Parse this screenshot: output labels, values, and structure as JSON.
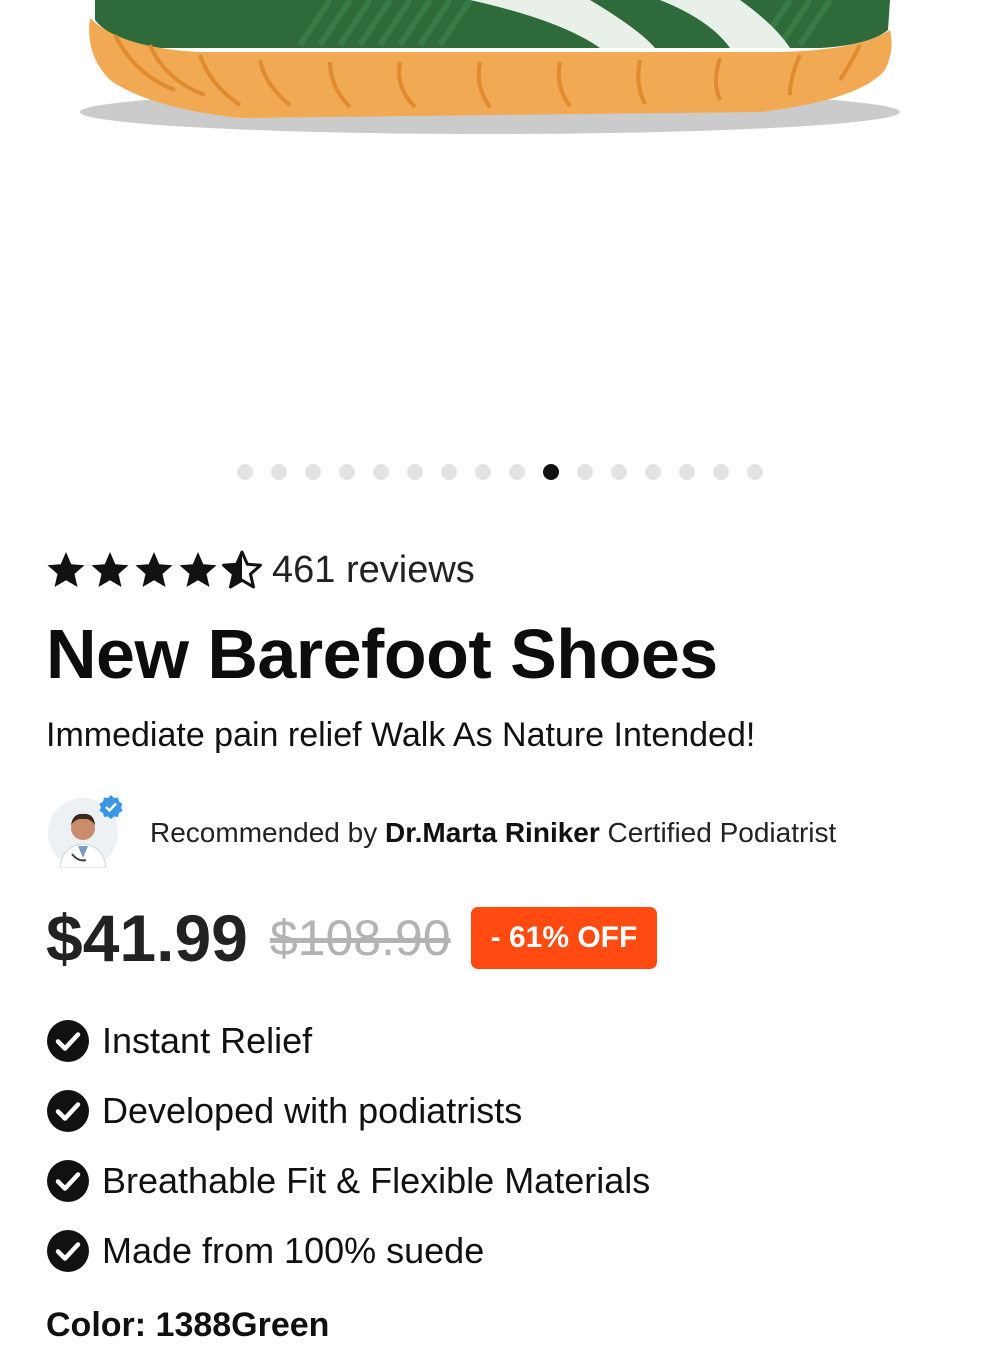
{
  "product": {
    "image_alt": "green barefoot shoe with gum sole",
    "carousel": {
      "total": 16,
      "active_index": 9
    },
    "rating": {
      "value": 4.5,
      "max": 5,
      "reviews_label": "461 reviews"
    },
    "title": "New Barefoot Shoes",
    "subtitle": "Immediate pain relief Walk As Nature Intended!",
    "recommendation": {
      "prefix": "Recommended by ",
      "name": "Dr.Marta Riniker",
      "suffix": " Certified Podiatrist"
    },
    "price": {
      "current": "$41.99",
      "original": "$108.90",
      "discount_label": "- 61% OFF"
    },
    "features": [
      "Instant Relief",
      "Developed with podiatrists",
      "Breathable Fit & Flexible Materials",
      "Made from 100% suede"
    ],
    "color_label": "Color: 1388Green"
  },
  "colors": {
    "discount_badge": "#ff4a12",
    "dot_active": "#111111",
    "dot_inactive": "#e3e3e3",
    "old_price": "#b3b3b3",
    "shoe_upper": "#2f6b3a",
    "shoe_sole": "#f2a953",
    "verified": "#3a97e8"
  },
  "icons": {
    "star_full": "star-icon",
    "star_half": "star-half-icon",
    "feature_check": "check-circle-icon",
    "verified_badge": "verified-badge-icon"
  }
}
